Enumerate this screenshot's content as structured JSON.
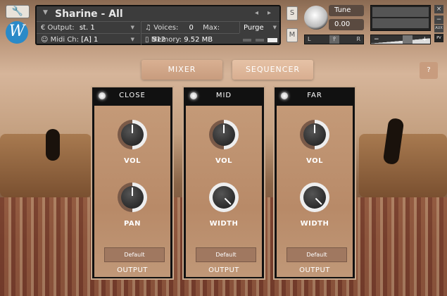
{
  "header": {
    "instrument": "Sharine - All",
    "output_label": "Output:",
    "output_value": "st. 1",
    "midi_label": "Midi Ch:",
    "midi_value": "[A]  1",
    "voices_label": "Voices:",
    "voices_value": "0",
    "max_label": "Max:",
    "max_value": "512",
    "memory_label": "Memory:",
    "memory_value": "9.52 MB",
    "purge_label": "Purge",
    "solo": "S",
    "mute": "M",
    "tune_label": "Tune",
    "tune_value": "0.00",
    "pan_l": "L",
    "pan_r": "R",
    "vol_minus": "−",
    "vol_plus": "+",
    "close": "×",
    "minimize": "−",
    "aux": "AUX",
    "pv": "PV",
    "logo": "W"
  },
  "tabs": {
    "mixer": "MIXER",
    "sequencer": "SEQUENCER",
    "help": "?"
  },
  "channels": [
    {
      "name": "CLOSE",
      "knob1": "VOL",
      "knob2": "PAN",
      "knob1_value": 0.5,
      "knob2_value": 0.5,
      "output_value": "Default",
      "output_label": "OUTPUT"
    },
    {
      "name": "MID",
      "knob1": "VOL",
      "knob2": "WIDTH",
      "knob1_value": 0.5,
      "knob2_value": 1.0,
      "output_value": "Default",
      "output_label": "OUTPUT"
    },
    {
      "name": "FAR",
      "knob1": "VOL",
      "knob2": "WIDTH",
      "knob1_value": 0.5,
      "knob2_value": 1.0,
      "output_value": "Default",
      "output_label": "OUTPUT"
    }
  ]
}
